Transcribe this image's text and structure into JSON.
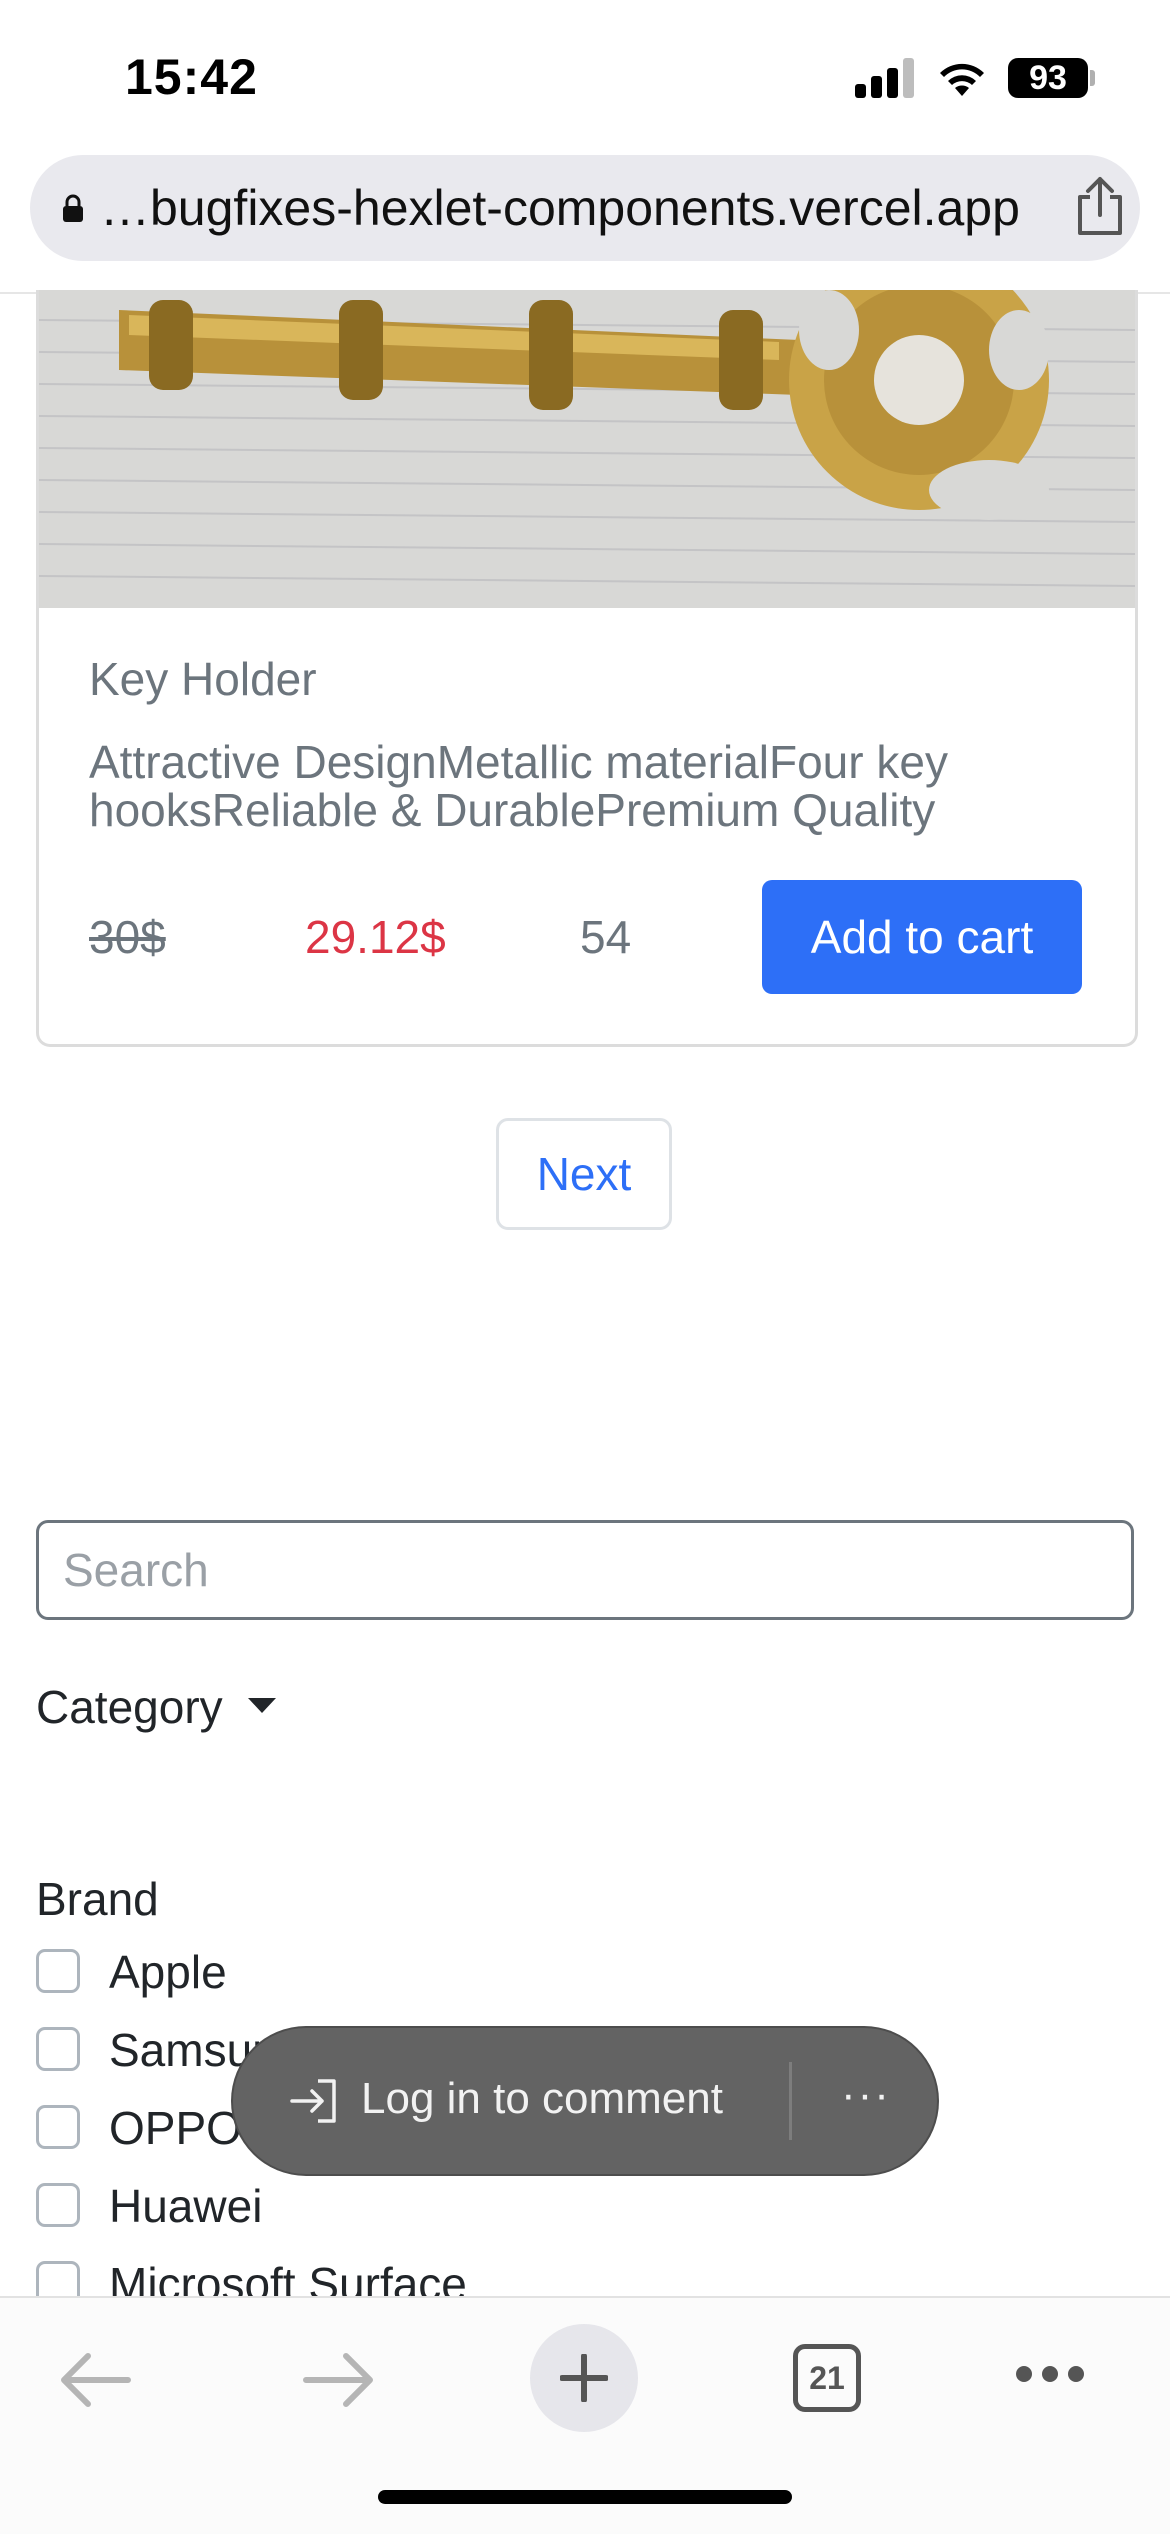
{
  "status_bar": {
    "time": "15:42",
    "battery": "93",
    "icons": [
      "signal-icon",
      "wifi-icon",
      "battery-icon"
    ]
  },
  "browser": {
    "url": "…bugfixes-hexlet-components.vercel.app",
    "icons": [
      "lock-icon",
      "share-icon"
    ]
  },
  "product": {
    "image_alt": "Gold key holder",
    "title": "Key Holder",
    "description": "Attractive DesignMetallic materialFour key hooksReliable & DurablePremium Quality",
    "old_price": "30$",
    "price": "29.12$",
    "stock": "54",
    "add_to_cart_label": "Add to cart"
  },
  "pagination": {
    "next_label": "Next"
  },
  "filters": {
    "search_placeholder": "Search",
    "category_label": "Category",
    "brand_heading": "Brand",
    "brands": [
      "Apple",
      "Samsung",
      "OPPO",
      "Huawei",
      "Microsoft Surface"
    ]
  },
  "toast": {
    "label": "Log in to comment",
    "more": "···"
  },
  "toolbar": {
    "tab_count": "21",
    "icons": [
      "back-arrow-icon",
      "forward-arrow-icon",
      "plus-icon",
      "tabs-icon",
      "more-icon"
    ]
  },
  "colors": {
    "primary": "#2d6ff7",
    "sale_price": "#dc3545",
    "muted_text": "#6c757d",
    "toast_bg": "#636363"
  }
}
